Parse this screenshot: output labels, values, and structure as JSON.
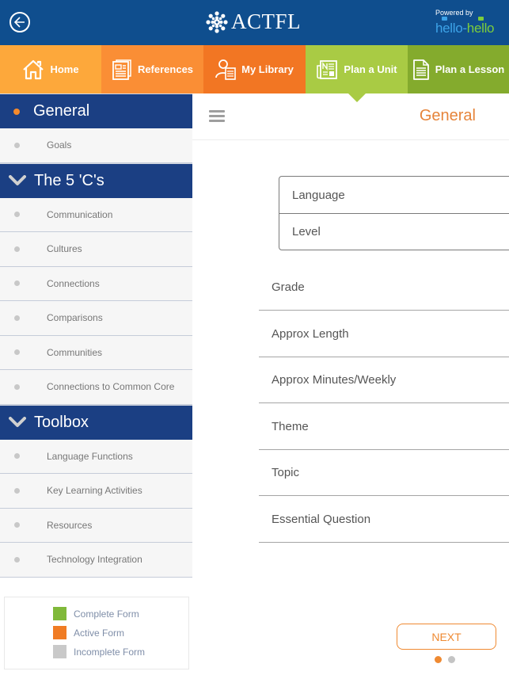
{
  "header": {
    "logo_text": "ACTFL",
    "powered_by": "Powered by",
    "partner_part1": "hello",
    "partner_dash": "-",
    "partner_part2": "hello"
  },
  "nav": {
    "tabs": [
      {
        "label": "Home",
        "icon": "home-icon"
      },
      {
        "label": "References",
        "icon": "document-icon"
      },
      {
        "label": "My Library",
        "icon": "user-library-icon"
      },
      {
        "label": "Plan a Unit",
        "icon": "newspaper-icon",
        "active": true
      },
      {
        "label": "Plan a Lesson",
        "icon": "page-icon"
      }
    ]
  },
  "sidebar": {
    "sections": [
      {
        "title": "General",
        "items": [
          "Goals"
        ]
      },
      {
        "title": "The 5 'C's",
        "items": [
          "Communication",
          "Cultures",
          "Connections",
          "Comparisons",
          "Communities",
          "Connections to Common Core"
        ]
      },
      {
        "title": "Toolbox",
        "items": [
          "Language Functions",
          "Key Learning Activities",
          "Resources",
          "Technology Integration"
        ]
      }
    ],
    "legend": [
      {
        "label": "Complete Form",
        "color": "#80b93a"
      },
      {
        "label": "Active Form",
        "color": "#f07c24"
      },
      {
        "label": "Incomplete Form",
        "color": "#c9c9c9"
      }
    ]
  },
  "main": {
    "title": "General",
    "box_fields": [
      {
        "placeholder": "Language"
      },
      {
        "placeholder": "Level"
      }
    ],
    "fields": [
      {
        "placeholder": "Grade"
      },
      {
        "placeholder": "Approx Length"
      },
      {
        "placeholder": "Approx Minutes/Weekly"
      },
      {
        "placeholder": "Theme"
      },
      {
        "placeholder": "Topic"
      },
      {
        "placeholder": "Essential Question"
      }
    ],
    "next_label": "NEXT",
    "pager": {
      "current": 1,
      "total": 2
    }
  },
  "colors": {
    "header_bg": "#0f4e8e",
    "sidebar_header_bg": "#1b3f83",
    "accent_orange": "#e6843a",
    "active_tab": "#a9cb44"
  }
}
